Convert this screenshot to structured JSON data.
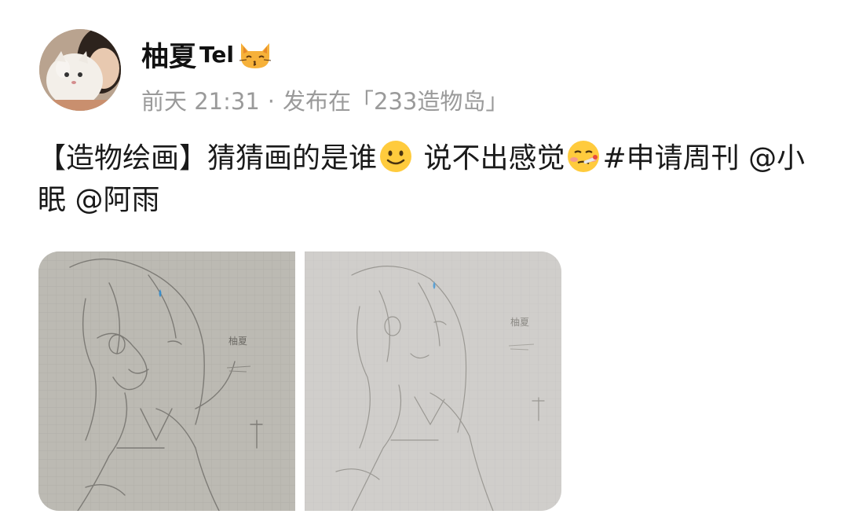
{
  "post": {
    "author": {
      "name": "柚夏",
      "name_suffix": "Tel",
      "avatar": "avatar-photo"
    },
    "meta": {
      "time": "前天 21:31",
      "separator": "·",
      "published_in": "发布在「233造物岛」"
    },
    "content": {
      "line_part1": "【造物绘画】猜猜画的是谁",
      "line_part2": " 说不出感觉",
      "line_part3": "#申请周刊 @小眠 @阿雨",
      "emoji_1": "slightly-smiling-face",
      "emoji_2": "face-with-thermometer"
    },
    "images": [
      {
        "name": "sketch-photo-1",
        "signature": "柚夏"
      },
      {
        "name": "sketch-photo-2",
        "signature": "柚夏"
      }
    ],
    "colors": {
      "meta_gray": "#9a9a9a",
      "text": "#1a1a1a",
      "paper_1": "#bcbab3",
      "paper_2": "#d0cecb"
    }
  }
}
